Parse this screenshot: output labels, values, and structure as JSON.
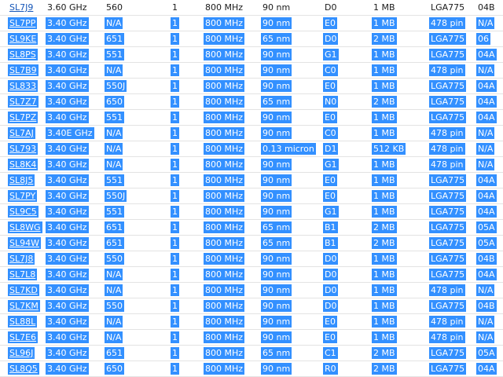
{
  "table": {
    "rows": [
      {
        "selected": false,
        "cells": [
          "SL7J9",
          "3.60 GHz",
          "560",
          "1",
          "800 MHz",
          "90 nm",
          "D0",
          "1 MB",
          "LGA775",
          "04B"
        ]
      },
      {
        "selected": true,
        "cells": [
          "SL7PP",
          "3.40 GHz",
          "N/A",
          "1",
          "800 MHz",
          "90 nm",
          "E0",
          "1 MB",
          "478 pin",
          "N/A"
        ]
      },
      {
        "selected": true,
        "cells": [
          "SL9KE",
          "3.40 GHz",
          "651",
          "1",
          "800 MHz",
          "65 nm",
          "D0",
          "2 MB",
          "LGA775",
          "06"
        ]
      },
      {
        "selected": true,
        "cells": [
          "SL8PS",
          "3.40 GHz",
          "551",
          "1",
          "800 MHz",
          "90 nm",
          "G1",
          "1 MB",
          "LGA775",
          "04A"
        ]
      },
      {
        "selected": true,
        "cells": [
          "SL7B9",
          "3.40 GHz",
          "N/A",
          "1",
          "800 MHz",
          "90 nm",
          "C0",
          "1 MB",
          "478 pin",
          "N/A"
        ]
      },
      {
        "selected": true,
        "cells": [
          "SL833",
          "3.40 GHz",
          "550J",
          "1",
          "800 MHz",
          "90 nm",
          "E0",
          "1 MB",
          "LGA775",
          "04A"
        ]
      },
      {
        "selected": true,
        "cells": [
          "SL7Z7",
          "3.40 GHz",
          "650",
          "1",
          "800 MHz",
          "65 nm",
          "N0",
          "2 MB",
          "LGA775",
          "04A"
        ]
      },
      {
        "selected": true,
        "cells": [
          "SL7PZ",
          "3.40 GHz",
          "551",
          "1",
          "800 MHz",
          "90 nm",
          "E0",
          "1 MB",
          "LGA775",
          "04A"
        ]
      },
      {
        "selected": true,
        "cells": [
          "SL7AJ",
          "3.40E GHz",
          "N/A",
          "1",
          "800 MHz",
          "90 nm",
          "C0",
          "1 MB",
          "478 pin",
          "N/A"
        ]
      },
      {
        "selected": true,
        "cells": [
          "SL793",
          "3.40 GHz",
          "N/A",
          "1",
          "800 MHz",
          "0.13 micron",
          "D1",
          "512 KB",
          "478 pin",
          "N/A"
        ]
      },
      {
        "selected": true,
        "cells": [
          "SL8K4",
          "3.40 GHz",
          "N/A",
          "1",
          "800 MHz",
          "90 nm",
          "G1",
          "1 MB",
          "478 pin",
          "N/A"
        ]
      },
      {
        "selected": true,
        "cells": [
          "SL8J5",
          "3.40 GHz",
          "551",
          "1",
          "800 MHz",
          "90 nm",
          "E0",
          "1 MB",
          "LGA775",
          "04A"
        ]
      },
      {
        "selected": true,
        "cells": [
          "SL7PY",
          "3.40 GHz",
          "550J",
          "1",
          "800 MHz",
          "90 nm",
          "E0",
          "1 MB",
          "LGA775",
          "04A"
        ]
      },
      {
        "selected": true,
        "cells": [
          "SL9C5",
          "3.40 GHz",
          "551",
          "1",
          "800 MHz",
          "90 nm",
          "G1",
          "1 MB",
          "LGA775",
          "04A"
        ]
      },
      {
        "selected": true,
        "cells": [
          "SL8WG",
          "3.40 GHz",
          "651",
          "1",
          "800 MHz",
          "65 nm",
          "B1",
          "2 MB",
          "LGA775",
          "05A"
        ]
      },
      {
        "selected": true,
        "cells": [
          "SL94W",
          "3.40 GHz",
          "651",
          "1",
          "800 MHz",
          "65 nm",
          "B1",
          "2 MB",
          "LGA775",
          "05A"
        ]
      },
      {
        "selected": true,
        "cells": [
          "SL7J8",
          "3.40 GHz",
          "550",
          "1",
          "800 MHz",
          "90 nm",
          "D0",
          "1 MB",
          "LGA775",
          "04B"
        ]
      },
      {
        "selected": true,
        "cells": [
          "SL7L8",
          "3.40 GHz",
          "N/A",
          "1",
          "800 MHz",
          "90 nm",
          "D0",
          "1 MB",
          "LGA775",
          "04A"
        ]
      },
      {
        "selected": true,
        "cells": [
          "SL7KD",
          "3.40 GHz",
          "N/A",
          "1",
          "800 MHz",
          "90 nm",
          "D0",
          "1 MB",
          "478 pin",
          "N/A"
        ]
      },
      {
        "selected": true,
        "cells": [
          "SL7KM",
          "3.40 GHz",
          "550",
          "1",
          "800 MHz",
          "90 nm",
          "D0",
          "1 MB",
          "LGA775",
          "04B"
        ]
      },
      {
        "selected": true,
        "cells": [
          "SL88L",
          "3.40 GHz",
          "N/A",
          "1",
          "800 MHz",
          "90 nm",
          "E0",
          "1 MB",
          "478 pin",
          "N/A"
        ]
      },
      {
        "selected": true,
        "cells": [
          "SL7E6",
          "3.40 GHz",
          "N/A",
          "1",
          "800 MHz",
          "90 nm",
          "E0",
          "1 MB",
          "478 pin",
          "N/A"
        ]
      },
      {
        "selected": true,
        "cells": [
          "SL96J",
          "3.40 GHz",
          "651",
          "1",
          "800 MHz",
          "65 nm",
          "C1",
          "2 MB",
          "LGA775",
          "05A"
        ]
      },
      {
        "selected": true,
        "cells": [
          "SL8Q5",
          "3.40 GHz",
          "650",
          "1",
          "800 MHz",
          "90 nm",
          "R0",
          "2 MB",
          "LGA775",
          "04A"
        ]
      }
    ]
  },
  "colors": {
    "selection": "#3390ff",
    "selection_text": "#ffffff",
    "link": "#1556b8"
  }
}
